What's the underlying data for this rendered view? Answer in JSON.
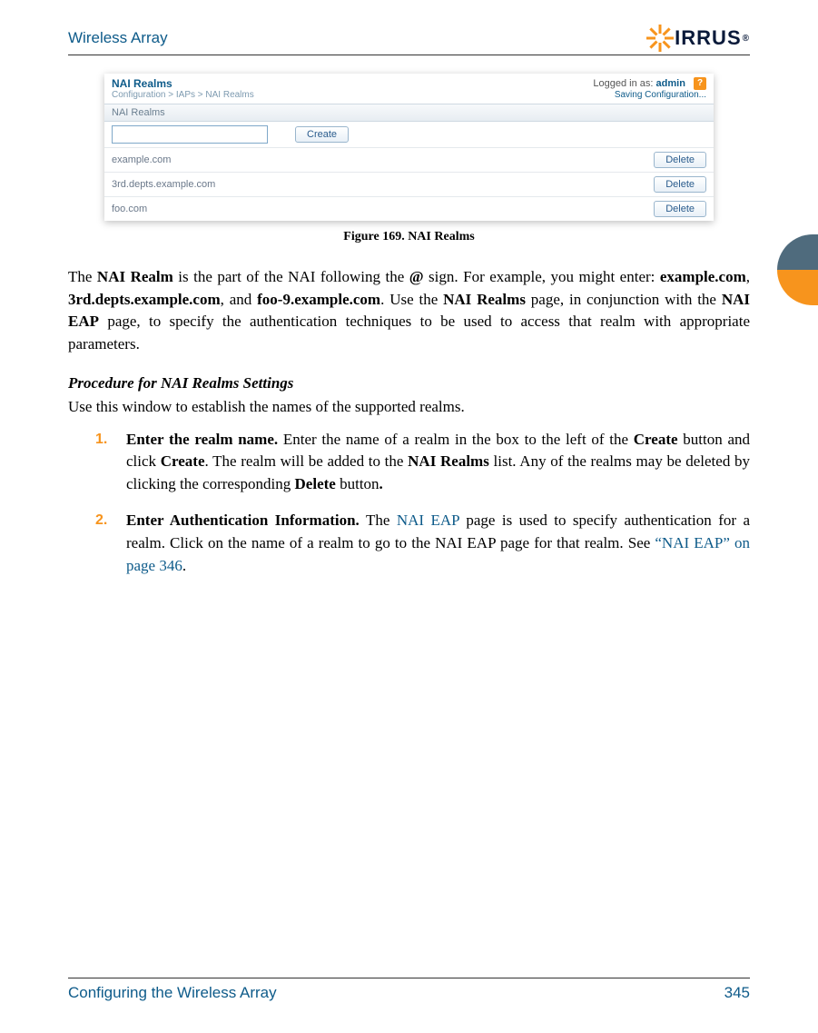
{
  "header": {
    "title": "Wireless Array",
    "logo_text": "IRRUS",
    "reg": "®"
  },
  "screenshot": {
    "panel_title": "NAI Realms",
    "breadcrumb": "Configuration > IAPs > NAI Realms",
    "login_prefix": "Logged in as: ",
    "login_user": "admin",
    "saving": "Saving Configuration...",
    "list_label": "NAI Realms",
    "create_btn": "Create",
    "delete_btn": "Delete",
    "realms": [
      {
        "name": "example.com"
      },
      {
        "name": "3rd.depts.example.com"
      },
      {
        "name": "foo.com"
      }
    ]
  },
  "figure_caption": "Figure 169. NAI Realms",
  "paragraph": {
    "p1a": "The ",
    "p1b": "NAI Realm",
    "p1c": " is the part of the NAI following the ",
    "p1d": "@",
    "p1e": " sign. For example, you might enter: ",
    "p1f": "example.com",
    "p1g": ", ",
    "p1h": "3rd.depts.example.com",
    "p1i": ", and ",
    "p1j": "foo-9.example.com",
    "p1k": ". Use the ",
    "p1l": "NAI Realms",
    "p1m": " page, in conjunction with the ",
    "p1n": "NAI EAP",
    "p1o": " page, to specify the authentication techniques to be used to access that realm with appropriate parameters."
  },
  "procedure": {
    "heading": "Procedure for NAI Realms Settings",
    "intro": "Use this window to establish the names of the supported realms.",
    "steps": [
      {
        "num": "1.",
        "s1": "Enter the realm name.",
        "s2": " Enter the name of a realm in the box to the left of the ",
        "s3": "Create",
        "s4": " button and click ",
        "s5": "Create",
        "s6": ". The realm will be added to the ",
        "s7": "NAI Realms",
        "s8": " list. Any of the realms may be deleted by clicking the corresponding ",
        "s9": "Delete",
        "s10": " button",
        "s11": "."
      },
      {
        "num": "2.",
        "s1": "Enter Authentication Information.",
        "s2": " The ",
        "s3": "NAI EAP",
        "s4": " page is used to specify authentication for a realm. Click on the name of a realm to go to the NAI EAP page for that realm. See ",
        "s5": "“NAI EAP” on page 346",
        "s6": "."
      }
    ]
  },
  "footer": {
    "left": "Configuring the Wireless Array",
    "right": "345"
  }
}
